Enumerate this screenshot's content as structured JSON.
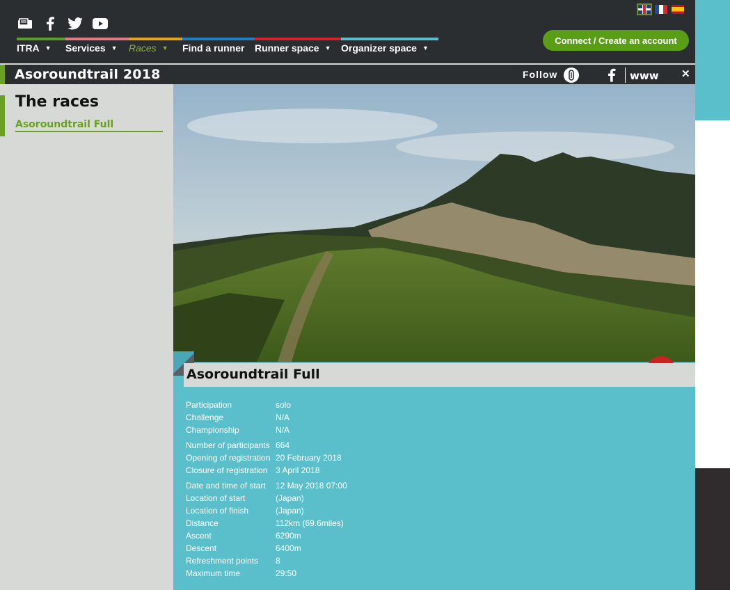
{
  "header": {
    "social": [
      {
        "name": "newsletter-icon"
      },
      {
        "name": "facebook-icon"
      },
      {
        "name": "twitter-icon"
      },
      {
        "name": "youtube-icon"
      }
    ],
    "languages": [
      "English",
      "Français",
      "Español"
    ],
    "nav": [
      {
        "label": "ITRA",
        "caret": "▼",
        "color": "#5a9d2d"
      },
      {
        "label": "Services",
        "caret": "▼",
        "color": "#e07a86"
      },
      {
        "label": "Races",
        "caret": "▼",
        "color": "#e5a120",
        "active": true
      },
      {
        "label": "Find a runner",
        "caret": "",
        "color": "#1f7ec2"
      },
      {
        "label": "Runner space",
        "caret": "▼",
        "color": "#d4202a"
      },
      {
        "label": "Organizer space",
        "caret": "▼",
        "color": "#5bbfcb"
      }
    ],
    "connect_label": "Connect / Create an account"
  },
  "event": {
    "title": "Asoroundtrail 2018",
    "follow_label": "Follow",
    "www_label": "www",
    "close_label": "✕"
  },
  "sidebar": {
    "title": "The races",
    "race_link": "Asoroundtrail Full"
  },
  "race": {
    "name": "Asoroundtrail Full",
    "groups": [
      [
        {
          "label": "Participation",
          "value": "solo"
        },
        {
          "label": "Challenge",
          "value": "N/A"
        },
        {
          "label": "Championship",
          "value": "N/A"
        }
      ],
      [
        {
          "label": "Number of participants",
          "value": "664"
        },
        {
          "label": "Opening of registration",
          "value": "20 February 2018"
        },
        {
          "label": "Closure of registration",
          "value": "3 April 2018"
        }
      ],
      [
        {
          "label": "Date and time of start",
          "value": "12 May 2018 07:00"
        },
        {
          "label": "Location of start",
          "value": "(Japan)"
        },
        {
          "label": "Location of finish",
          "value": "(Japan)"
        },
        {
          "label": "Distance",
          "value": "112km (69.6miles)"
        },
        {
          "label": "Ascent",
          "value": "6290m"
        },
        {
          "label": "Descent",
          "value": "6400m"
        },
        {
          "label": "Refreshment points",
          "value": "8"
        },
        {
          "label": "Maximum time",
          "value": "29:50"
        }
      ]
    ]
  },
  "colors": {
    "accent_green": "#6aa124",
    "button_green": "#5a9d16",
    "teal": "#5bbfcb",
    "dark": "#2b2e30"
  }
}
